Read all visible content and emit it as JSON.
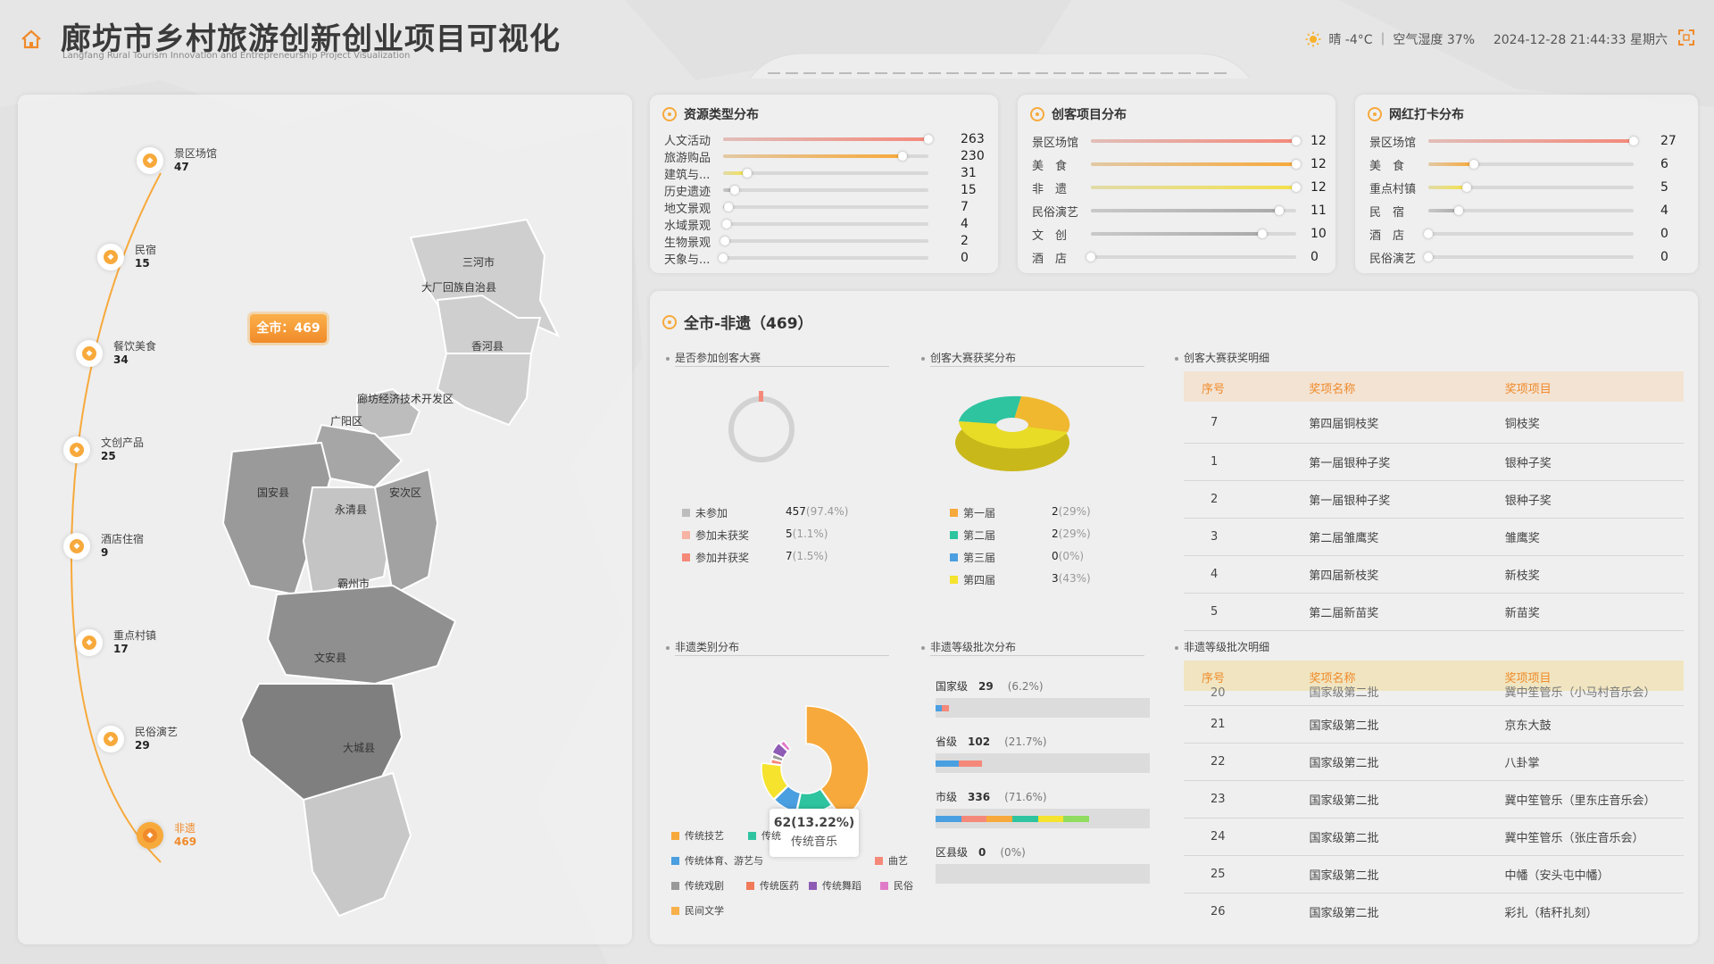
{
  "header": {
    "title": "廊坊市乡村旅游创新创业项目可视化",
    "subtitle": "Langfang Rural Tourism Innovation and Entrepreneurship Project Visualization",
    "weather": "晴 -4°C ｜ 空气湿度 37%",
    "datetime": "2024-12-28 21:44:33 星期六"
  },
  "map": {
    "total_badge": "全市：469",
    "districts": [
      "三河市",
      "大厂回族自治县",
      "香河县",
      "廊坊经济技术开发区",
      "广阳区",
      "国安县",
      "永清县",
      "安次区",
      "霸州市",
      "文安县",
      "大城县"
    ]
  },
  "timeline": [
    {
      "label": "景区场馆",
      "value": "47"
    },
    {
      "label": "民宿",
      "value": "15"
    },
    {
      "label": "餐饮美食",
      "value": "34"
    },
    {
      "label": "文创产品",
      "value": "25"
    },
    {
      "label": "酒店住宿",
      "value": "9"
    },
    {
      "label": "重点村镇",
      "value": "17"
    },
    {
      "label": "民俗演艺",
      "value": "29"
    },
    {
      "label": "非遗",
      "value": "469"
    }
  ],
  "resource": {
    "title": "资源类型分布",
    "items": [
      {
        "label": "人文活动",
        "value": 263,
        "color": "#f4897a"
      },
      {
        "label": "旅游购品",
        "value": 230,
        "color": "#f7a93b"
      },
      {
        "label": "建筑与...",
        "value": 31,
        "color": "#f3e14a"
      },
      {
        "label": "历史遗迹",
        "value": 15,
        "color": "#aaaaaa"
      },
      {
        "label": "地文景观",
        "value": 7,
        "color": "#aaaaaa"
      },
      {
        "label": "水域景观",
        "value": 4,
        "color": "#aaaaaa"
      },
      {
        "label": "生物景观",
        "value": 2,
        "color": "#aaaaaa"
      },
      {
        "label": "天象与...",
        "value": 0,
        "color": "#aaaaaa"
      }
    ]
  },
  "maker": {
    "title": "创客项目分布",
    "items": [
      {
        "label": "景区场馆",
        "value": 12,
        "color": "#f4897a"
      },
      {
        "label": "美　食",
        "value": 12,
        "color": "#f7a93b"
      },
      {
        "label": "非　遗",
        "value": 12,
        "color": "#f3e14a"
      },
      {
        "label": "民俗演艺",
        "value": 11,
        "color": "#aaaaaa"
      },
      {
        "label": "文　创",
        "value": 10,
        "color": "#aaaaaa"
      },
      {
        "label": "酒　店",
        "value": 0,
        "color": "#aaaaaa"
      }
    ]
  },
  "checkin": {
    "title": "网红打卡分布",
    "items": [
      {
        "label": "景区场馆",
        "value": 27,
        "color": "#f4897a"
      },
      {
        "label": "美　食",
        "value": 6,
        "color": "#f7a93b"
      },
      {
        "label": "重点村镇",
        "value": 5,
        "color": "#f3e14a"
      },
      {
        "label": "民　宿",
        "value": 4,
        "color": "#aaaaaa"
      },
      {
        "label": "酒　店",
        "value": 0,
        "color": "#aaaaaa"
      },
      {
        "label": "民俗演艺",
        "value": 0,
        "color": "#aaaaaa"
      }
    ]
  },
  "main": {
    "title": "全市-非遗（469）",
    "participate": {
      "title": "是否参加创客大赛",
      "items": [
        {
          "label": "未参加",
          "value": "457",
          "pct": "(97.4%)",
          "color": "#bdbdbd"
        },
        {
          "label": "参加未获奖",
          "value": "5",
          "pct": "(1.1%)",
          "color": "#f7b3a3"
        },
        {
          "label": "参加并获奖",
          "value": "7",
          "pct": "(1.5%)",
          "color": "#f4897a"
        }
      ]
    },
    "awards_pie": {
      "title": "创客大赛获奖分布",
      "items": [
        {
          "label": "第一届",
          "value": "2",
          "pct": "(29%)",
          "color": "#f7a93b"
        },
        {
          "label": "第二届",
          "value": "2",
          "pct": "(29%)",
          "color": "#2ec4a0"
        },
        {
          "label": "第三届",
          "value": "0",
          "pct": "(0%)",
          "color": "#4a9fe0"
        },
        {
          "label": "第四届",
          "value": "3",
          "pct": "(43%)",
          "color": "#f5e32e"
        }
      ]
    },
    "award_table": {
      "title": "创客大赛获奖明细",
      "headers": [
        "序号",
        "奖项名称",
        "奖项项目"
      ],
      "rows": [
        [
          "7",
          "第四届铜枝奖",
          "铜枝奖"
        ],
        [
          "1",
          "第一届银种子奖",
          "银种子奖"
        ],
        [
          "2",
          "第一届银种子奖",
          "银种子奖"
        ],
        [
          "3",
          "第二届雏鹰奖",
          "雏鹰奖"
        ],
        [
          "4",
          "第四届新枝奖",
          "新枝奖"
        ],
        [
          "5",
          "第二届新苗奖",
          "新苗奖"
        ]
      ]
    },
    "category": {
      "title": "非遗类别分布",
      "tooltip_value": "62(13.22%)",
      "tooltip_label": "传统音乐",
      "legend": [
        {
          "label": "传统技艺",
          "color": "#f7a93b"
        },
        {
          "label": "传统",
          "color": "#2ec4a0"
        },
        {
          "label": "传统体育、游艺与",
          "color": "#4a9fe0"
        },
        {
          "label": "曲艺",
          "color": "#f4897a"
        },
        {
          "label": "传统戏剧",
          "color": "#999999"
        },
        {
          "label": "传统医药",
          "color": "#f07a5a"
        },
        {
          "label": "传统舞蹈",
          "color": "#8e5bb5"
        },
        {
          "label": "民俗",
          "color": "#e07ac8"
        },
        {
          "label": "民间文学",
          "color": "#f7b04a"
        }
      ]
    },
    "level": {
      "title": "非遗等级批次分布",
      "items": [
        {
          "label": "国家级",
          "value": "29",
          "pct": "(6.2%)",
          "fill": 0.062
        },
        {
          "label": "省级",
          "value": "102",
          "pct": "(21.7%)",
          "fill": 0.217
        },
        {
          "label": "市级",
          "value": "336",
          "pct": "(71.6%)",
          "fill": 0.716
        },
        {
          "label": "区县级",
          "value": "0",
          "pct": "(0%)",
          "fill": 0
        }
      ]
    },
    "level_table": {
      "title": "非遗等级批次明细",
      "headers": [
        "序号",
        "奖项名称",
        "奖项项目"
      ],
      "partial_row": [
        "20",
        "国家级第二批",
        "冀中笙管乐（小马村音乐会）"
      ],
      "rows": [
        [
          "21",
          "国家级第二批",
          "京东大鼓"
        ],
        [
          "22",
          "国家级第二批",
          "八卦掌"
        ],
        [
          "23",
          "国家级第二批",
          "冀中笙管乐（里东庄音乐会）"
        ],
        [
          "24",
          "国家级第二批",
          "冀中笙管乐（张庄音乐会）"
        ],
        [
          "25",
          "国家级第二批",
          "中幡（安头屯中幡）"
        ],
        [
          "26",
          "国家级第二批",
          "彩扎（秸秆扎刻）"
        ]
      ]
    }
  }
}
